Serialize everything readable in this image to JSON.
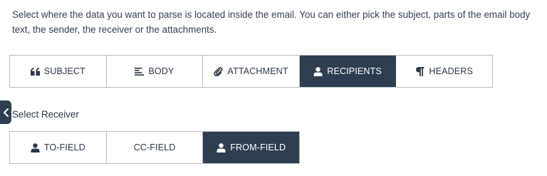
{
  "description": "Select where the data you want to parse is located inside the email. You can either pick the subject, parts of the email body text, the sender, the receiver or the attachments.",
  "source_types": [
    {
      "label": "SUBJECT",
      "icon": "quote-icon",
      "active": false
    },
    {
      "label": "BODY",
      "icon": "align-left-icon",
      "active": false
    },
    {
      "label": "ATTACHMENT",
      "icon": "paperclip-icon",
      "active": false
    },
    {
      "label": "RECIPIENTS",
      "icon": "user-icon",
      "active": true
    },
    {
      "label": "HEADERS",
      "icon": "paragraph-icon",
      "active": false
    }
  ],
  "receiver_section": {
    "label": "Select Receiver",
    "options": [
      {
        "label": "TO-FIELD",
        "icon": "user-icon",
        "active": false
      },
      {
        "label": "CC-FIELD",
        "icon": "",
        "active": false
      },
      {
        "label": "FROM-FIELD",
        "icon": "user-icon",
        "active": true
      }
    ]
  },
  "colors": {
    "active_bg": "#2e3e50",
    "border": "#b9bdc2",
    "text": "#2c3a4a"
  }
}
